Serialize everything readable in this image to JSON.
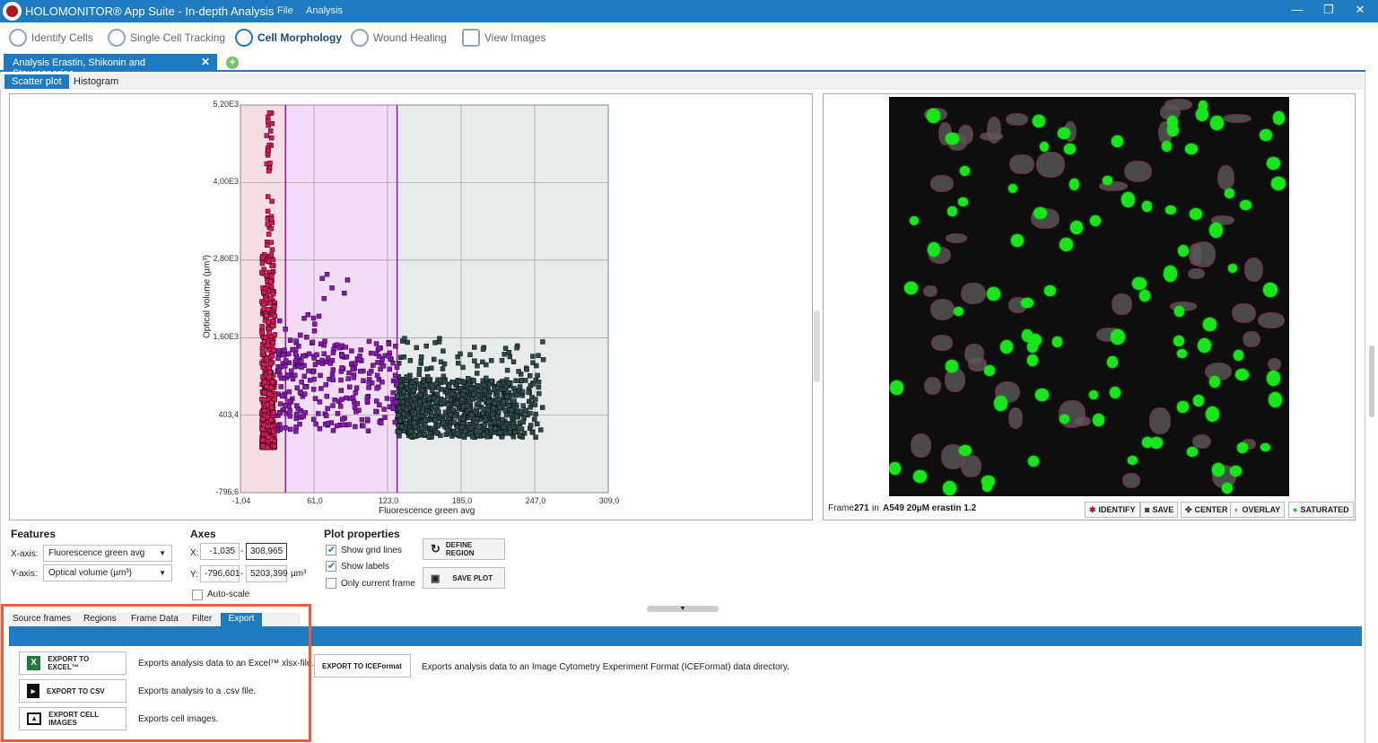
{
  "app": {
    "title": "HOLOMONITOR® App Suite - In-depth Analysis",
    "menu": [
      "File",
      "Analysis"
    ],
    "window_controls": [
      "—",
      "❐",
      "✕"
    ]
  },
  "toolbar": {
    "items": [
      {
        "label": "Identify Cells",
        "icon": "identify-cells-icon"
      },
      {
        "label": "Single Cell Tracking",
        "icon": "cell-tracking-icon"
      },
      {
        "label": "Cell Morphology",
        "icon": "cell-morphology-icon",
        "active": true
      },
      {
        "label": "Wound Healing",
        "icon": "wound-healing-icon"
      },
      {
        "label": "View Images",
        "icon": "view-images-icon"
      }
    ]
  },
  "tabs": {
    "document": "Analysis Erastin, Shikonin and Staurosporine",
    "close": "✕",
    "add": "+"
  },
  "subtabs": [
    "Scatter plot",
    "Histogram"
  ],
  "plot": {
    "yticks": [
      "5,20E3",
      "4,00E3",
      "2,80E3",
      "1,60E3",
      "403,4",
      "-796,6"
    ],
    "xticks": [
      "-1,04",
      "61,0",
      "123,0",
      "185,0",
      "247,0",
      "309,0"
    ],
    "xlabel": "Fluorescence green avg",
    "ylabel": "Optical volume (µm³)",
    "colors": {
      "region1": "#d8185a",
      "region2": "#8a17b5",
      "region3": "#2c4a4a"
    }
  },
  "chart_data": {
    "type": "scatter",
    "title": "",
    "xlabel": "Fluorescence green avg",
    "ylabel": "Optical volume (µm³)",
    "xlim": [
      -1.04,
      309.0
    ],
    "ylim": [
      -796.6,
      5200
    ],
    "grid": true,
    "regions": [
      {
        "x_range": [
          -1.04,
          37
        ],
        "color": "#f7dde4"
      },
      {
        "x_range": [
          37,
          131
        ],
        "color": "#f3dcf5"
      },
      {
        "x_range": [
          131,
          309
        ],
        "color": "#e8ebea"
      }
    ],
    "series": [
      {
        "color": "#d8185a",
        "x_range": [
          17,
          28
        ],
        "y_range": [
          -100,
          5100
        ]
      },
      {
        "color": "#8a17b5",
        "x_range": [
          28,
          131
        ],
        "y_range": [
          0,
          2000
        ]
      },
      {
        "color": "#2c4a4a",
        "x_range": [
          131,
          257
        ],
        "y_range": [
          0,
          1600
        ]
      }
    ]
  },
  "image": {
    "frame_label": "Frame",
    "frame_number": "271",
    "in_label": "in",
    "well_name": "A549 20µM erastin 1.2",
    "buttons": [
      {
        "label": "IDENTIFY",
        "icon": "identify-icon"
      },
      {
        "label": "SAVE",
        "icon": "camera-icon"
      },
      {
        "label": "CENTER",
        "icon": "center-icon"
      },
      {
        "label": "OVERLAY",
        "icon": "overlay-icon"
      },
      {
        "label": "SATURATED",
        "icon": "saturated-icon"
      }
    ]
  },
  "features": {
    "title": "Features",
    "x_label": "X-axis:",
    "x_value": "Fluorescence green avg",
    "y_label": "Y-axis:",
    "y_value": "Optical volume (µm³)"
  },
  "axes": {
    "title": "Axes",
    "x_label": "X:",
    "x_min": "-1,035",
    "x_max": "308,965",
    "y_label": "Y:",
    "y_min": "-796,601",
    "y_max": "5203,399",
    "unit": "µm³",
    "dash": "-",
    "autoscale_label": "Auto-scale"
  },
  "plot_properties": {
    "title": "Plot properties",
    "grid_label": "Show grid lines",
    "labels_label": "Show labels",
    "current_frame_label": "Only current frame",
    "define_region": "DEFINE REGION",
    "save_plot": "SAVE PLOT"
  },
  "bottom_tabs": [
    "Source frames",
    "Regions",
    "Frame Data",
    "Filter",
    "Export"
  ],
  "export": {
    "excel_btn": "EXPORT TO EXCEL™",
    "excel_desc": "Exports analysis data to an Excel™ xlsx-file.",
    "csv_btn": "EXPORT TO CSV",
    "csv_desc": "Exports analysis to a .csv file.",
    "images_btn": "EXPORT CELL IMAGES",
    "images_desc": "Exports cell images.",
    "ice_btn": "EXPORT TO ICEFormat",
    "ice_desc": "Exports analysis data to an Image Cytometry Experiment Format (ICEFormat) data directory."
  }
}
